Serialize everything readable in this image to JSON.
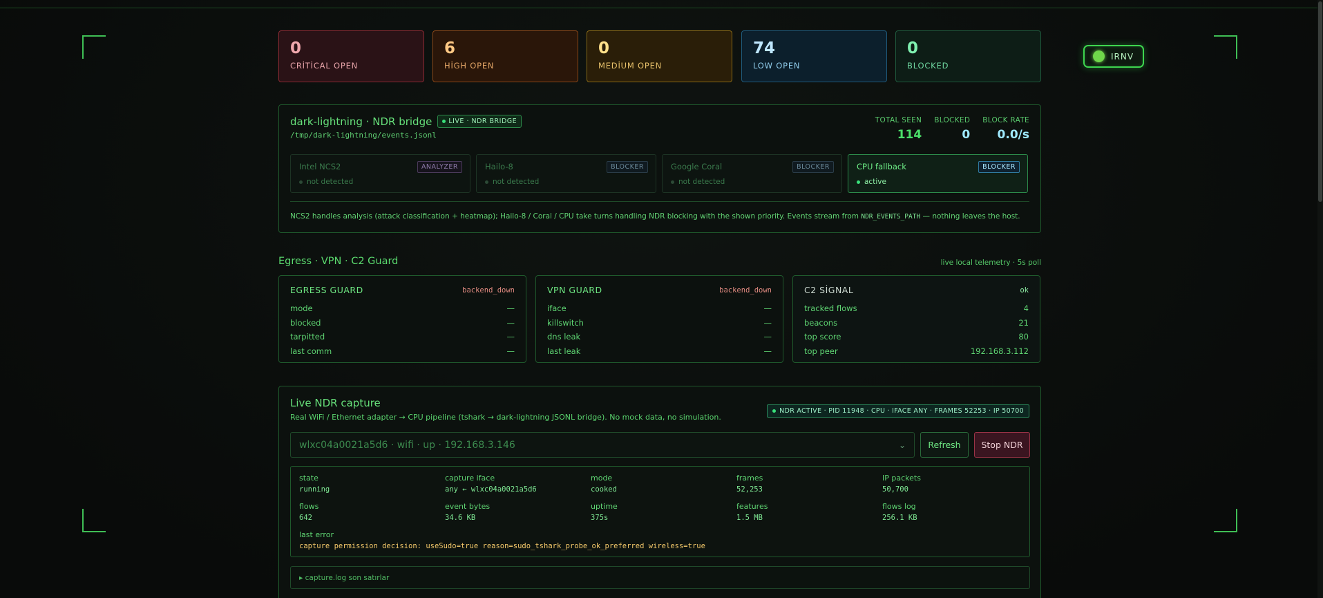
{
  "badge_irnv": "IRNV",
  "stats": [
    {
      "value": "0",
      "label": "CRİTİCAL OPEN"
    },
    {
      "value": "6",
      "label": "HİGH OPEN"
    },
    {
      "value": "0",
      "label": "MEDİUM OPEN"
    },
    {
      "value": "74",
      "label": "LOW OPEN"
    },
    {
      "value": "0",
      "label": "BLOCKED"
    }
  ],
  "ndr": {
    "title": "dark-lightning · NDR bridge",
    "live_badge": "LIVE · NDR BRIDGE",
    "path": "/tmp/dark-lightning/events.jsonl",
    "total_seen_label": "TOTAL SEEN",
    "total_seen": "114",
    "blocked_label": "BLOCKED",
    "blocked": "0",
    "block_rate_label": "BLOCK RATE",
    "block_rate": "0.0/s",
    "devices": [
      {
        "name": "Intel NCS2",
        "tag": "ANALYZER",
        "status": "not detected"
      },
      {
        "name": "Hailo-8",
        "tag": "BLOCKER",
        "status": "not detected"
      },
      {
        "name": "Google Coral",
        "tag": "BLOCKER",
        "status": "not detected"
      },
      {
        "name": "CPU fallback",
        "tag": "BLOCKER",
        "status": "active"
      }
    ],
    "note_before": "NCS2 handles analysis (attack classification + heatmap); Hailo-8 / Coral / CPU take turns handling NDR blocking with the shown priority. Events stream from ",
    "note_code": "NDR_EVENTS_PATH",
    "note_after": " — nothing leaves the host."
  },
  "section": {
    "title": "Egress · VPN · C2 Guard",
    "subtitle": "live local telemetry · 5s poll"
  },
  "guards": [
    {
      "title": "EGRESS GUARD",
      "status": "backend_down",
      "rows": [
        {
          "k": "mode",
          "v": "—"
        },
        {
          "k": "blocked",
          "v": "—"
        },
        {
          "k": "tarpitted",
          "v": "—"
        },
        {
          "k": "last comm",
          "v": "—"
        }
      ]
    },
    {
      "title": "VPN GUARD",
      "status": "backend_down",
      "rows": [
        {
          "k": "iface",
          "v": "—"
        },
        {
          "k": "killswitch",
          "v": "—"
        },
        {
          "k": "dns leak",
          "v": "—"
        },
        {
          "k": "last leak",
          "v": "—"
        }
      ]
    },
    {
      "title": "C2 SİGNAL",
      "status": "ok",
      "rows": [
        {
          "k": "tracked flows",
          "v": "4"
        },
        {
          "k": "beacons",
          "v": "21"
        },
        {
          "k": "top score",
          "v": "80"
        },
        {
          "k": "top peer",
          "v": "192.168.3.112"
        }
      ]
    }
  ],
  "live": {
    "title": "Live NDR capture",
    "subtitle": "Real WiFi / Ethernet adapter → CPU pipeline (tshark → dark-lightning JSONL bridge). No mock data, no simulation.",
    "badge": "NDR ACTIVE · PID 11948 · CPU · IFACE ANY · FRAMES 52253 · IP 50700",
    "select_value": "wlxc04a0021a5d6 · wifi · up · 192.168.3.146",
    "refresh_label": "Refresh",
    "stop_label": "Stop NDR",
    "metrics": [
      {
        "k": "state",
        "v": "running"
      },
      {
        "k": "capture iface",
        "v": "any ← wlxc04a0021a5d6"
      },
      {
        "k": "mode",
        "v": "cooked"
      },
      {
        "k": "frames",
        "v": "52,253"
      },
      {
        "k": "IP packets",
        "v": "50,700"
      },
      {
        "k": "flows",
        "v": "642"
      },
      {
        "k": "event bytes",
        "v": "34.6 KB"
      },
      {
        "k": "uptime",
        "v": "375s"
      },
      {
        "k": "features",
        "v": "1.5 MB"
      },
      {
        "k": "flows log",
        "v": "256.1 KB"
      }
    ],
    "last_error_label": "last error",
    "last_error": "capture permission decision: useSudo=true reason=sudo_tshark_probe_ok_preferred wireless=true",
    "log_summary": "▸ capture.log son satırlar"
  }
}
